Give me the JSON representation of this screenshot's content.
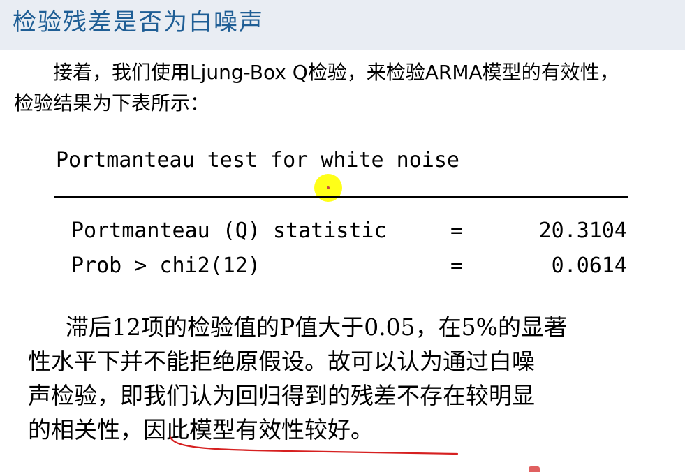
{
  "slide_title": "检验残差是否为白噪声",
  "intro": {
    "line1": "接着，我们使用Ljung-Box Q检验，来检验ARMA模型的有效性，",
    "line2": "检验结果为下表所示："
  },
  "test_output": {
    "heading": "Portmanteau test for white noise",
    "rows": [
      {
        "label": "Portmanteau (Q) statistic",
        "eq": "=",
        "value": "20.3104"
      },
      {
        "label": "Prob > chi2(12)",
        "eq": "=",
        "value": "0.0614"
      }
    ]
  },
  "conclusion": {
    "lines": [
      "滞后12项的检验值的P值大于0.05，在5%的显著",
      "性水平下并不能拒绝原假设。故可以认为通过白噪",
      "声检验，即我们认为回归得到的残差不存在较明显",
      "的相关性，因此模型有效性较好。"
    ]
  },
  "colors": {
    "title": "#1f5e95",
    "title_bg": "#e9edf3",
    "annotation_underline": "#d62020",
    "cursor_highlight": "#ffff00"
  }
}
